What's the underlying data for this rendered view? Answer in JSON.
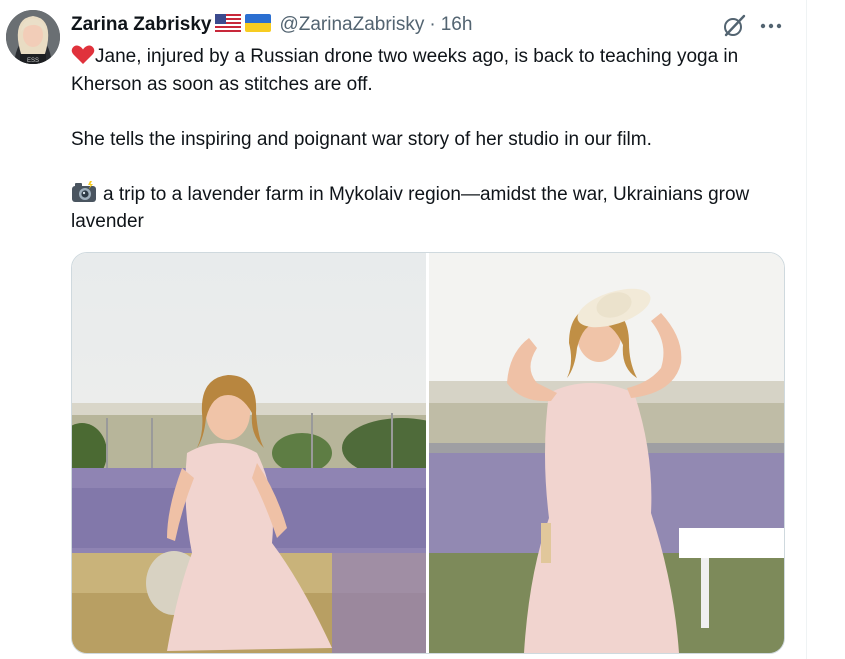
{
  "tweet": {
    "author_name": "Zarina Zabrisky",
    "flags": [
      "us-flag-icon",
      "ukraine-flag-icon"
    ],
    "handle": "@ZarinaZabrisky",
    "separator": "·",
    "time": "16h",
    "paragraphs": [
      "Jane, injured by a Russian drone two weeks ago, is back to teaching yoga in Kherson as soon as stitches are off.",
      "She tells the inspiring and poignant war story of her studio in our film.",
      "a trip to a lavender farm in Mykolaiv region—amidst the war, Ukrainians grow lavender"
    ],
    "emojis": [
      "red-heart-icon",
      "camera-with-flash-icon"
    ],
    "media": [
      {
        "type": "photo",
        "subject": "woman in pink dress seated on hay bale in lavender field"
      },
      {
        "type": "photo",
        "subject": "woman in pink dress standing in lavender field holding hat"
      }
    ]
  },
  "actions": {
    "grok_icon": "grok-icon",
    "more_icon": "more-icon"
  },
  "colors": {
    "text": "#0f1419",
    "secondary": "#536471",
    "border": "#cfd9de",
    "heart": "#e0323c",
    "dress": "#f1d4cf",
    "lavender": "#9c8cc4"
  }
}
